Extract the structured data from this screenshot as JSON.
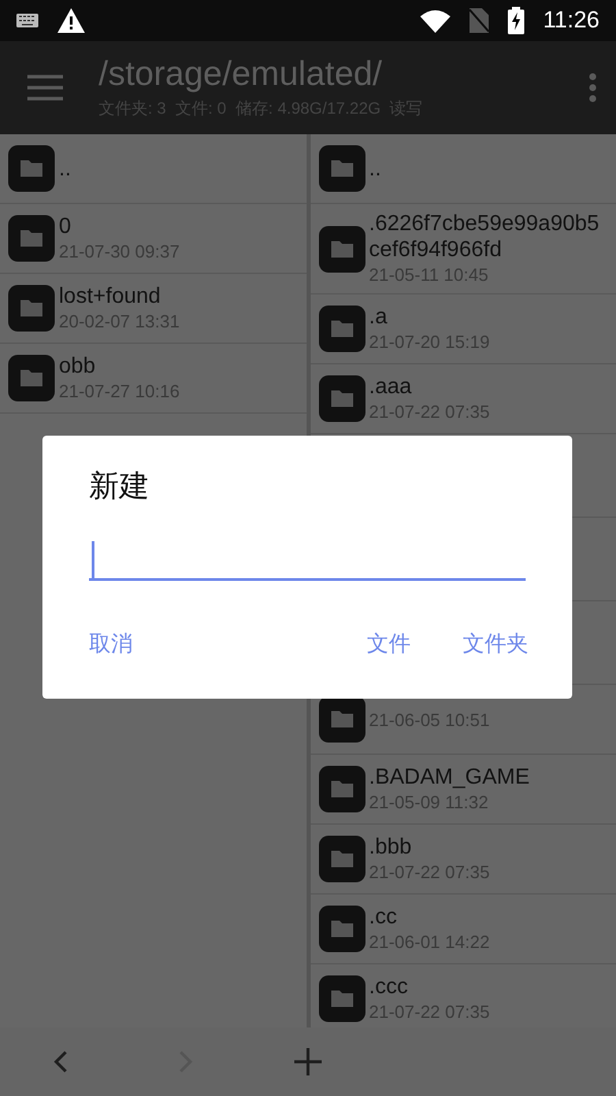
{
  "status_bar": {
    "time": "11:26"
  },
  "app_bar": {
    "path": "/storage/emulated/",
    "summary": "文件夹: 3  文件: 0  储存: 4.98G/17.22G  读写"
  },
  "left_pane": {
    "items": [
      {
        "kind": "folder",
        "name": ".."
      },
      {
        "kind": "folder",
        "name": "0",
        "date": "21-07-30 09:37"
      },
      {
        "kind": "folder",
        "name": "lost+found",
        "date": "20-02-07 13:31"
      },
      {
        "kind": "folder",
        "name": "obb",
        "date": "21-07-27 10:16"
      }
    ]
  },
  "right_pane": {
    "items": [
      {
        "kind": "folder",
        "name": ".."
      },
      {
        "kind": "folder",
        "name": ".6226f7cbe59e99a90b5cef6f94f966fd",
        "date": "21-05-11 10:45"
      },
      {
        "kind": "folder",
        "name": ".a",
        "date": "21-07-20 15:19"
      },
      {
        "kind": "folder",
        "name": ".aaa",
        "date": "21-07-22 07:35"
      },
      {
        "kind": "covered"
      },
      {
        "kind": "covered"
      },
      {
        "kind": "covered"
      },
      {
        "kind": "folder",
        "date": "21-06-05 10:51"
      },
      {
        "kind": "folder",
        "name": ".BADAM_GAME",
        "date": "21-05-09 11:32"
      },
      {
        "kind": "folder",
        "name": ".bbb",
        "date": "21-07-22 07:35"
      },
      {
        "kind": "folder",
        "name": ".cc",
        "date": "21-06-01 14:22"
      },
      {
        "kind": "folder",
        "name": ".ccc",
        "date": "21-07-22 07:35"
      }
    ]
  },
  "dialog": {
    "title": "新建",
    "buttons": [
      "取消",
      "文件",
      "文件夹"
    ]
  }
}
